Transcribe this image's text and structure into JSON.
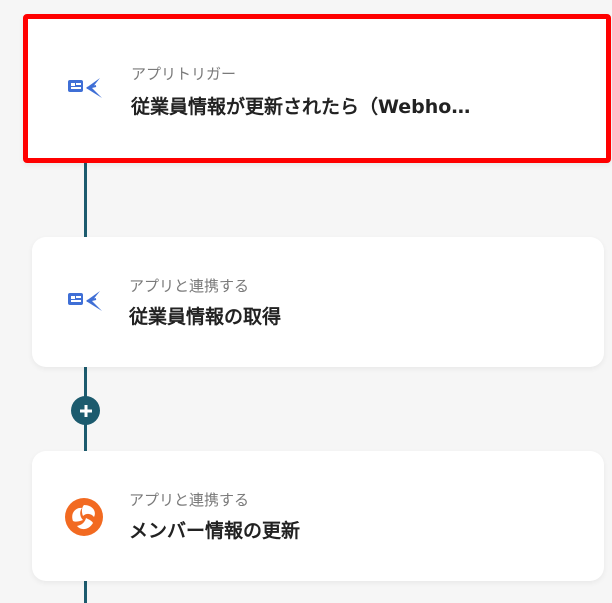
{
  "steps": [
    {
      "subtitle": "アプリトリガー",
      "title": "従業員情報が更新されたら（Webho…",
      "icon": "hr-app-icon",
      "highlighted": true
    },
    {
      "subtitle": "アプリと連携する",
      "title": "従業員情報の取得",
      "icon": "hr-app-icon",
      "highlighted": false
    },
    {
      "subtitle": "アプリと連携する",
      "title": "メンバー情報の更新",
      "icon": "orange-swirl-icon",
      "highlighted": false
    }
  ],
  "add_button": {
    "icon": "plus-icon"
  },
  "colors": {
    "highlight": "#ff0000",
    "connector": "#1c5b6e",
    "app1_blue": "#3f6fd6",
    "app2_orange": "#f26a21"
  }
}
